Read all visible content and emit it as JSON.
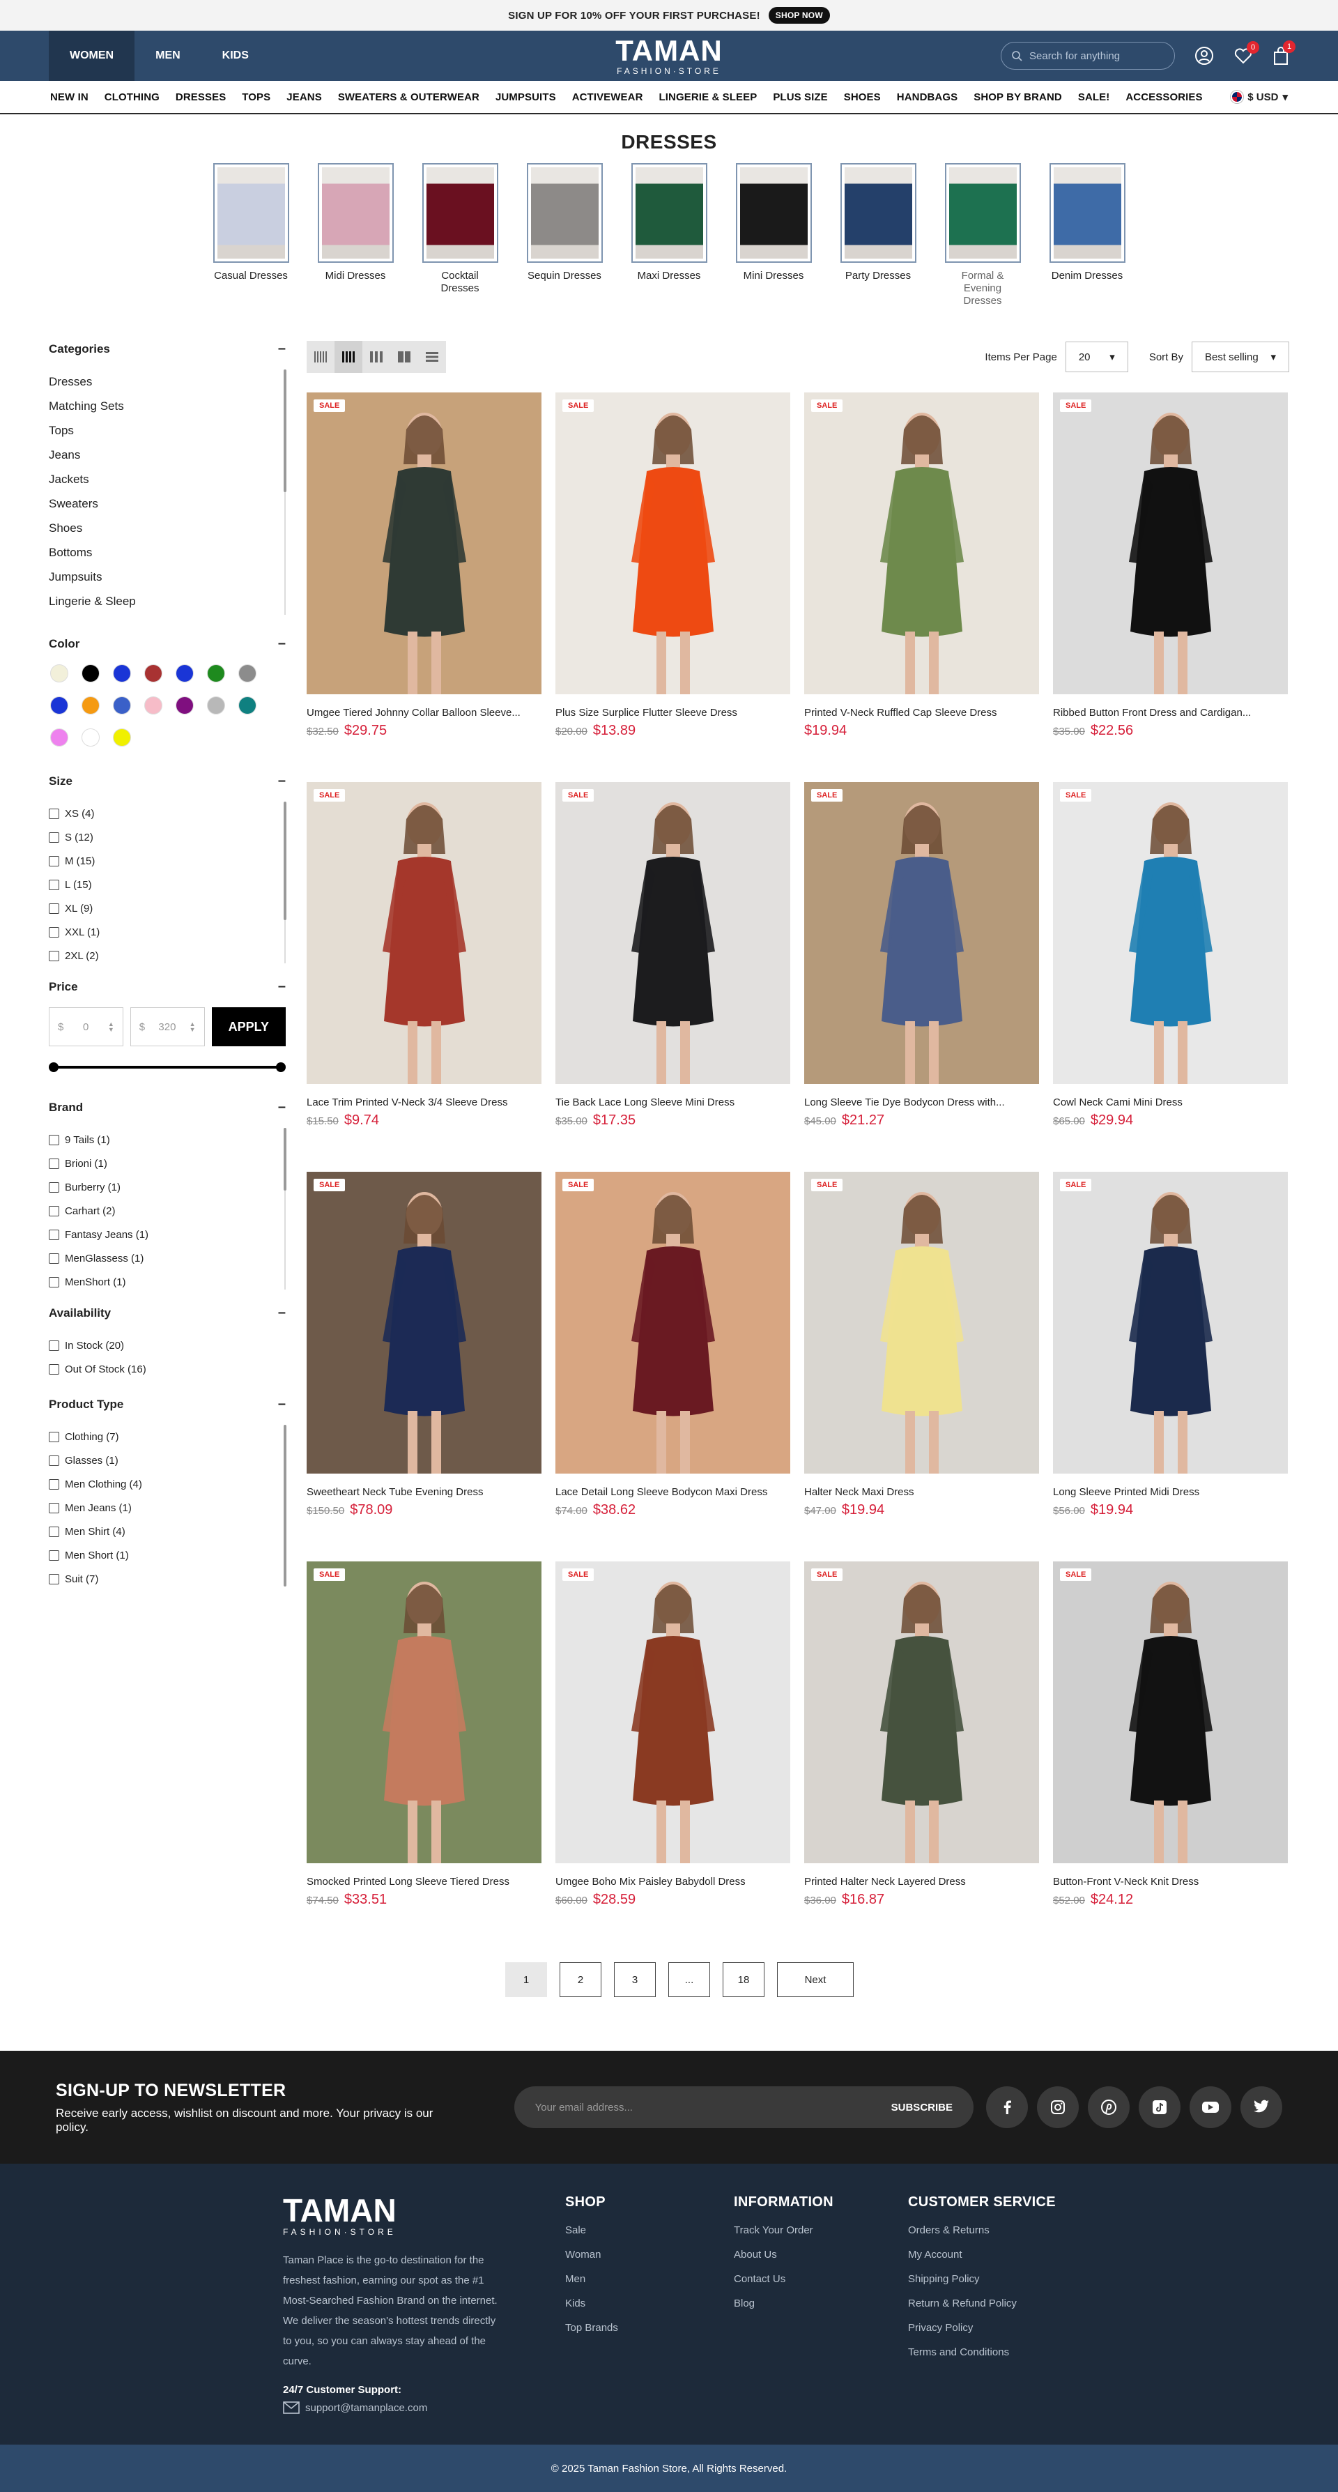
{
  "promo": {
    "text": "SIGN UP FOR 10% OFF YOUR FIRST PURCHASE!",
    "cta": "SHOP NOW"
  },
  "header": {
    "tabs": [
      "WOMEN",
      "MEN",
      "KIDS"
    ],
    "active_tab": "WOMEN",
    "logo_main": "TAMAN",
    "logo_sub": "FASHION·STORE",
    "search_placeholder": "Search for anything",
    "wishlist_count": "0",
    "cart_count": "1"
  },
  "nav": {
    "items": [
      "NEW IN",
      "CLOTHING",
      "DRESSES",
      "TOPS",
      "JEANS",
      "SWEATERS & OUTERWEAR",
      "JUMPSUITS",
      "ACTIVEWEAR",
      "LINGERIE & SLEEP",
      "PLUS SIZE",
      "SHOES",
      "HANDBAGS",
      "SHOP BY BRAND",
      "SALE!",
      "ACCESSORIES"
    ],
    "currency": "$ USD"
  },
  "page_title": "DRESSES",
  "categories": [
    {
      "label": "Casual Dresses",
      "color": "#c9cfe0"
    },
    {
      "label": "Midi Dresses",
      "color": "#d7a6b6"
    },
    {
      "label": "Cocktail Dresses",
      "color": "#6a1020"
    },
    {
      "label": "Sequin Dresses",
      "color": "#8d8a88"
    },
    {
      "label": "Maxi Dresses",
      "color": "#1f5a3c"
    },
    {
      "label": "Mini Dresses",
      "color": "#1a1a1a"
    },
    {
      "label": "Party Dresses",
      "color": "#24406a"
    },
    {
      "label": "Formal & Evening Dresses",
      "color": "#1d7150"
    },
    {
      "label": "Denim Dresses",
      "color": "#3e6ba7"
    }
  ],
  "filters": {
    "categories_title": "Categories",
    "categories": [
      "Dresses",
      "Matching Sets",
      "Tops",
      "Jeans",
      "Jackets",
      "Sweaters",
      "Shoes",
      "Bottoms",
      "Jumpsuits",
      "Lingerie & Sleep"
    ],
    "color_title": "Color",
    "colors": [
      "#f2f0da",
      "#000000",
      "#1a35d6",
      "#a83232",
      "#1a35d6",
      "#1e8a1e",
      "#8c8c8c",
      "#1a35d6",
      "#f59a12",
      "#3a60c8",
      "#f6bcc8",
      "#7f0f7f",
      "#b8b8b8",
      "#0f8080",
      "#ee82ee",
      "#ffffff",
      "#f0f000"
    ],
    "size_title": "Size",
    "sizes": [
      "XS (4)",
      "S (12)",
      "M (15)",
      "L (15)",
      "XL (9)",
      "XXL (1)",
      "2XL (2)"
    ],
    "price_title": "Price",
    "price_min": "0",
    "price_max": "320",
    "currency_symbol": "$",
    "apply_label": "APPLY",
    "brand_title": "Brand",
    "brands": [
      "9 Tails (1)",
      "Brioni (1)",
      "Burberry (1)",
      "Carhart (2)",
      "Fantasy Jeans (1)",
      "MenGlassess (1)",
      "MenShort (1)"
    ],
    "availability_title": "Availability",
    "availability": [
      "In Stock (20)",
      "Out Of Stock (16)"
    ],
    "type_title": "Product Type",
    "types": [
      "Clothing (7)",
      "Glasses (1)",
      "Men Clothing (4)",
      "Men Jeans (1)",
      "Men Shirt (4)",
      "Men Short (1)",
      "Suit (7)"
    ]
  },
  "toolbar": {
    "items_per_page_label": "Items Per Page",
    "items_per_page": "20",
    "sort_label": "Sort By",
    "sort_value": "Best selling"
  },
  "products": [
    {
      "name": "Umgee Tiered Johnny Collar Balloon Sleeve...",
      "old": "$32.50",
      "price": "$29.75",
      "bg": "#c7a27a",
      "dress": "#2f3a34",
      "sale": "SALE"
    },
    {
      "name": "Plus Size Surplice Flutter Sleeve Dress",
      "old": "$20.00",
      "price": "$13.89",
      "bg": "#ece8e2",
      "dress": "#ee4a12",
      "sale": "SALE"
    },
    {
      "name": "Printed V-Neck Ruffled Cap Sleeve Dress",
      "old": "",
      "price": "$19.94",
      "bg": "#e9e4dc",
      "dress": "#6e8a4c",
      "sale": "SALE"
    },
    {
      "name": "Ribbed Button Front Dress and Cardigan...",
      "old": "$35.00",
      "price": "$22.56",
      "bg": "#dcdcdc",
      "dress": "#111111",
      "sale": "SALE"
    },
    {
      "name": "Lace Trim Printed V-Neck 3/4 Sleeve Dress",
      "old": "$15.50",
      "price": "$9.74",
      "bg": "#e4ddd3",
      "dress": "#a5372b",
      "sale": "SALE"
    },
    {
      "name": "Tie Back Lace Long Sleeve Mini Dress",
      "old": "$35.00",
      "price": "$17.35",
      "bg": "#e2e0de",
      "dress": "#1c1c1e",
      "sale": "SALE"
    },
    {
      "name": "Long Sleeve Tie Dye Bodycon Dress with...",
      "old": "$45.00",
      "price": "$21.27",
      "bg": "#b59a7a",
      "dress": "#4a5d8a",
      "sale": "SALE"
    },
    {
      "name": "Cowl Neck Cami Mini Dress",
      "old": "$65.00",
      "price": "$29.94",
      "bg": "#e8e8e8",
      "dress": "#1f7fb3",
      "sale": "SALE"
    },
    {
      "name": "Sweetheart Neck Tube Evening Dress",
      "old": "$150.50",
      "price": "$78.09",
      "bg": "#6e5a4a",
      "dress": "#1c2a55",
      "sale": "SALE"
    },
    {
      "name": "Lace Detail Long Sleeve Bodycon Maxi Dress",
      "old": "$74.00",
      "price": "$38.62",
      "bg": "#d8a682",
      "dress": "#6a1a22",
      "sale": "SALE"
    },
    {
      "name": "Halter Neck Maxi Dress",
      "old": "$47.00",
      "price": "$19.94",
      "bg": "#d9d6d0",
      "dress": "#efe290",
      "sale": "SALE"
    },
    {
      "name": "Long Sleeve Printed Midi Dress",
      "old": "$56.00",
      "price": "$19.94",
      "bg": "#e0e0e0",
      "dress": "#1b2a4c",
      "sale": "SALE"
    },
    {
      "name": "Smocked Printed Long Sleeve Tiered Dress",
      "old": "$74.50",
      "price": "$33.51",
      "bg": "#7b8a5e",
      "dress": "#c47b5e",
      "sale": "SALE"
    },
    {
      "name": "Umgee Boho Mix Paisley Babydoll Dress",
      "old": "$60.00",
      "price": "$28.59",
      "bg": "#e6e6e6",
      "dress": "#8a3a22",
      "sale": "SALE"
    },
    {
      "name": "Printed Halter Neck Layered Dress",
      "old": "$36.00",
      "price": "$16.87",
      "bg": "#d8d4cf",
      "dress": "#46523e",
      "sale": "SALE"
    },
    {
      "name": "Button-Front V-Neck Knit Dress",
      "old": "$52.00",
      "price": "$24.12",
      "bg": "#cfcfcf",
      "dress": "#121212",
      "sale": "SALE"
    }
  ],
  "pagination": [
    "1",
    "2",
    "3",
    "...",
    "18"
  ],
  "pagination_next": "Next",
  "newsletter": {
    "title": "SIGN-UP TO NEWSLETTER",
    "text": "Receive early access, wishlist on discount and more. Your privacy is our policy.",
    "placeholder": "Your email address...",
    "button": "SUBSCRIBE",
    "socials": [
      "facebook-icon",
      "instagram-icon",
      "pinterest-icon",
      "tiktok-icon",
      "youtube-icon",
      "twitter-icon"
    ]
  },
  "footer": {
    "logo_main": "TAMAN",
    "logo_sub": "FASHION·STORE",
    "about": "Taman Place is the go-to destination for the freshest fashion, earning our spot as the #1 Most-Searched Fashion Brand on the internet. We deliver the season's hottest trends directly to you, so you can always stay ahead of the curve.",
    "support_title": "24/7 Customer Support:",
    "support_email": "support@tamanplace.com",
    "columns": [
      {
        "title": "SHOP",
        "links": [
          "Sale",
          "Woman",
          "Men",
          "Kids",
          "Top Brands"
        ]
      },
      {
        "title": "INFORMATION",
        "links": [
          "Track Your Order",
          "About Us",
          "Contact Us",
          "Blog"
        ]
      },
      {
        "title": "CUSTOMER SERVICE",
        "links": [
          "Orders & Returns",
          "My Account",
          "Shipping Policy",
          "Return & Refund Policy",
          "Privacy Policy",
          "Terms and Conditions"
        ]
      }
    ]
  },
  "copyright": "© 2025 Taman Fashion Store, All Rights Reserved."
}
